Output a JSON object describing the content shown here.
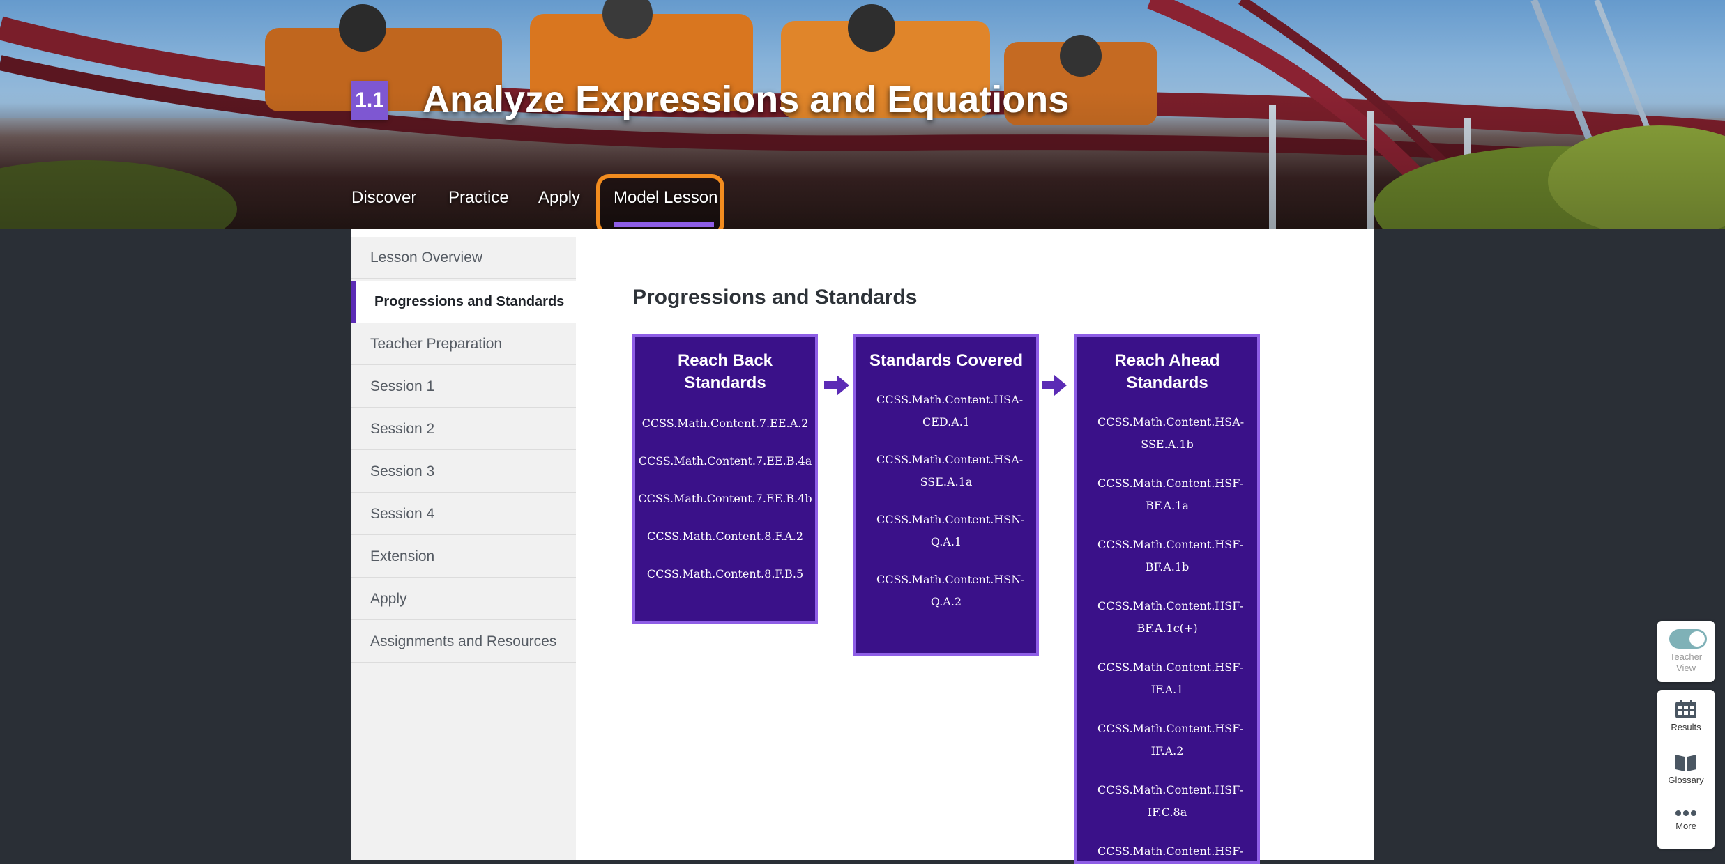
{
  "lesson": {
    "number": "1.1",
    "title": "Analyze Expressions and Equations"
  },
  "nav_tabs": [
    {
      "label": "Discover"
    },
    {
      "label": "Practice"
    },
    {
      "label": "Apply"
    },
    {
      "label": "Model Lesson",
      "active": true
    }
  ],
  "sidebar": {
    "items": [
      {
        "label": "Lesson Overview"
      },
      {
        "label": "Progressions and Standards",
        "active": true
      },
      {
        "label": "Teacher Preparation"
      },
      {
        "label": "Session 1"
      },
      {
        "label": "Session 2"
      },
      {
        "label": "Session 3"
      },
      {
        "label": "Session 4"
      },
      {
        "label": "Extension"
      },
      {
        "label": "Apply"
      },
      {
        "label": "Assignments and Resources"
      }
    ]
  },
  "content": {
    "section_title": "Progressions and Standards",
    "columns": [
      {
        "title": "Reach Back Standards",
        "items": [
          "CCSS.Math.Content.7.EE.A.2",
          "CCSS.Math.Content.7.EE.B.4a",
          "CCSS.Math.Content.7.EE.B.4b",
          "CCSS.Math.Content.8.F.A.2",
          "CCSS.Math.Content.8.F.B.5"
        ]
      },
      {
        "title": "Standards Covered",
        "items": [
          "CCSS.Math.Content.HSA-CED.A.1",
          "CCSS.Math.Content.HSA-SSE.A.1a",
          "CCSS.Math.Content.HSN-Q.A.1",
          "CCSS.Math.Content.HSN-Q.A.2"
        ]
      },
      {
        "title": "Reach Ahead Standards",
        "items": [
          "CCSS.Math.Content.HSA-SSE.A.1b",
          "CCSS.Math.Content.HSF-BF.A.1a",
          "CCSS.Math.Content.HSF-BF.A.1b",
          "CCSS.Math.Content.HSF-BF.A.1c(+)",
          "CCSS.Math.Content.HSF-IF.A.1",
          "CCSS.Math.Content.HSF-IF.A.2",
          "CCSS.Math.Content.HSF-IF.C.8a",
          "CCSS.Math.Content.HSF-"
        ]
      }
    ]
  },
  "tools": {
    "teacher_view": {
      "label": "Teacher View",
      "enabled": true
    },
    "results": {
      "label": "Results",
      "icon": "calendar-grid-icon"
    },
    "glossary": {
      "label": "Glossary",
      "icon": "book-icon"
    },
    "more": {
      "label": "More",
      "icon": "more-dots-icon"
    }
  },
  "colors": {
    "accent_purple": "#3a1189",
    "border_purple": "#8e5ee6",
    "highlight_orange": "#f28c1f",
    "toggle_teal": "#7fb1b7"
  }
}
